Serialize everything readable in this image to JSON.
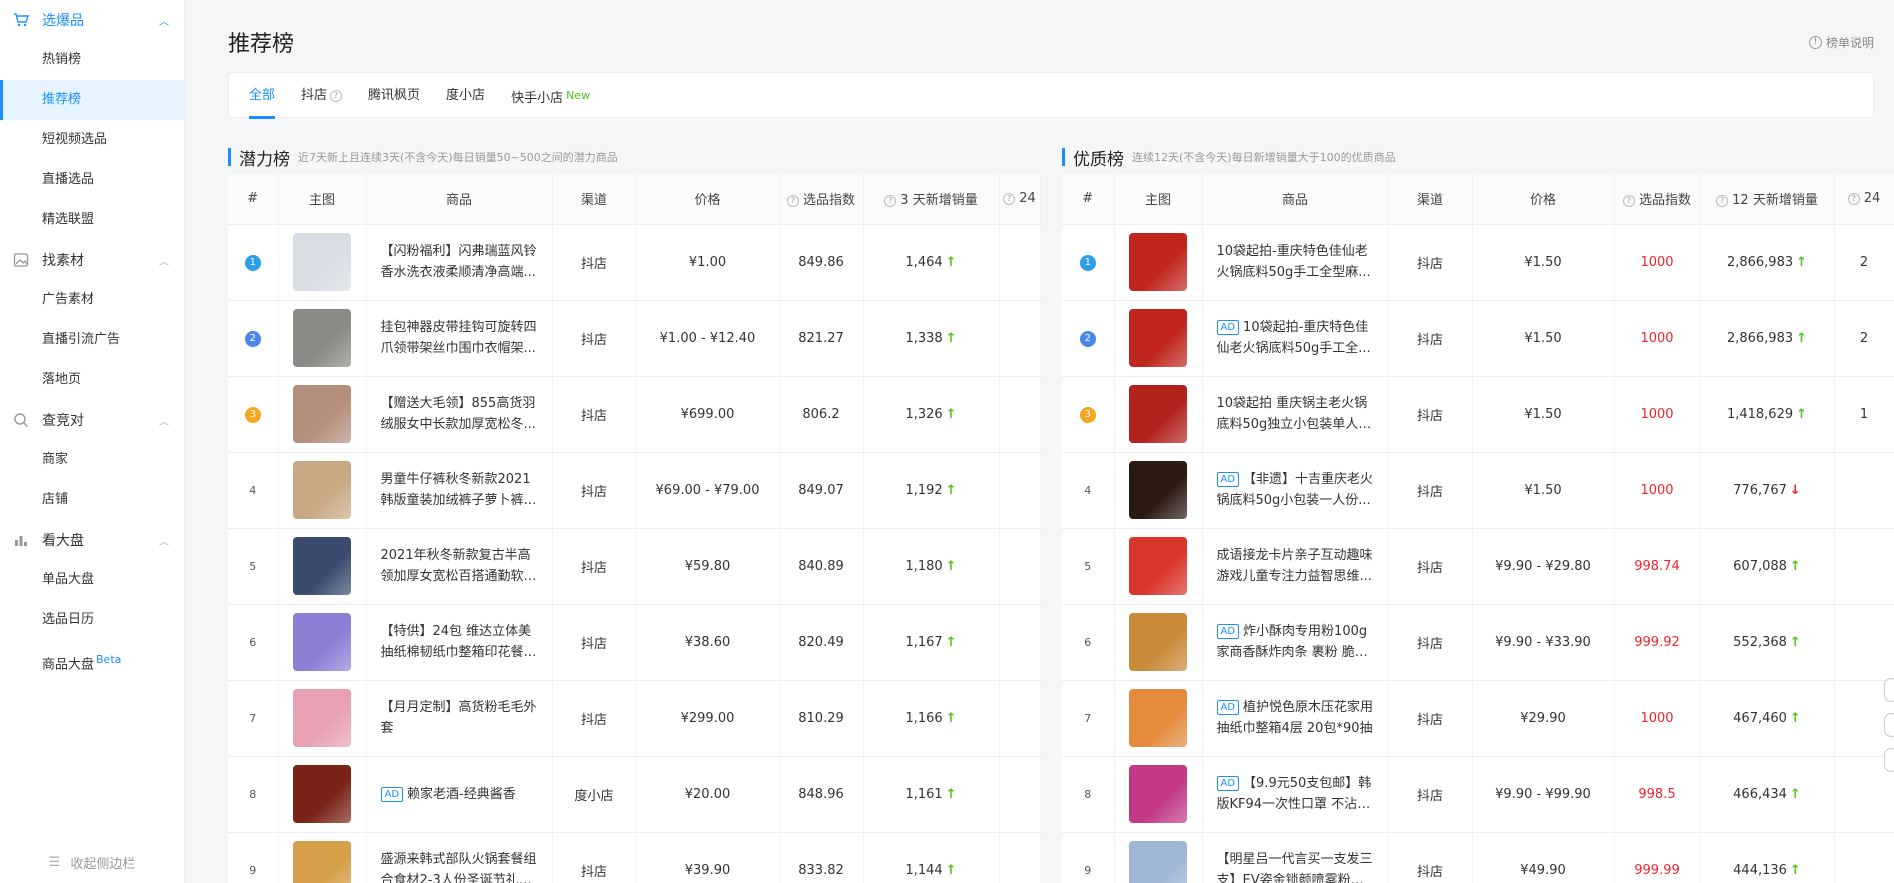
{
  "sidebar": {
    "groups": [
      {
        "label": "选爆品",
        "icon": "cart-icon",
        "items": [
          "热销榜",
          "推荐榜",
          "短视频选品",
          "直播选品",
          "精选联盟"
        ]
      },
      {
        "label": "找素材",
        "icon": "image-icon",
        "items": [
          "广告素材",
          "直播引流广告",
          "落地页"
        ]
      },
      {
        "label": "查竞对",
        "icon": "search-icon",
        "items": [
          "商家",
          "店铺"
        ]
      },
      {
        "label": "看大盘",
        "icon": "bar-chart-icon",
        "items": [
          "单品大盘",
          "选品日历",
          "商品大盘"
        ]
      }
    ],
    "beta_label": "Beta",
    "collapse_label": "收起侧边栏"
  },
  "page": {
    "title": "推荐榜",
    "help_label": "榜单说明"
  },
  "tabs": [
    {
      "label": "全部"
    },
    {
      "label": "抖店"
    },
    {
      "label": "腾讯枫页"
    },
    {
      "label": "度小店"
    },
    {
      "label": "快手小店",
      "badge": "New"
    }
  ],
  "left_panel": {
    "title": "潜力榜",
    "subtitle": "近7天新上且连续3天(不含今天)每日销量50~500之间的潜力商品",
    "columns": [
      "#",
      "主图",
      "商品",
      "渠道",
      "价格",
      "选品指数",
      "3 天新增销量",
      "24"
    ],
    "rows": [
      {
        "rank": "1",
        "name": "【闪粉福利】闪弗瑞蓝风铃香水洗衣液柔顺清净高端...",
        "ad": false,
        "channel": "抖店",
        "price": "¥1.00",
        "index": "849.86",
        "sales": "1,464",
        "trend": "up",
        "thumb": "#d9dde3"
      },
      {
        "rank": "2",
        "name": "挂包神器皮带挂钩可旋转四爪领带架丝巾围巾衣帽架...",
        "ad": false,
        "channel": "抖店",
        "price": "¥1.00 - ¥12.40",
        "index": "821.27",
        "sales": "1,338",
        "trend": "up",
        "thumb": "#8c8a86"
      },
      {
        "rank": "3",
        "name": "【赠送大毛领】855高货羽绒服女中长款加厚宽松冬...",
        "ad": false,
        "channel": "抖店",
        "price": "¥699.00",
        "index": "806.2",
        "sales": "1,326",
        "trend": "up",
        "thumb": "#b58f7d"
      },
      {
        "rank": "4",
        "name": "男童牛仔裤秋冬新款2021韩版童装加绒裤子萝卜裤中...",
        "ad": false,
        "channel": "抖店",
        "price": "¥69.00 - ¥79.00",
        "index": "849.07",
        "sales": "1,192",
        "trend": "up",
        "thumb": "#c9a984"
      },
      {
        "rank": "5",
        "name": "2021年秋冬新款复古半高领加厚女宽松百搭通勤软糯...",
        "ad": false,
        "channel": "抖店",
        "price": "¥59.80",
        "index": "840.89",
        "sales": "1,180",
        "trend": "up",
        "thumb": "#3a4b6e"
      },
      {
        "rank": "6",
        "name": "【特供】24包 维达立体美抽纸棉韧纸巾整箱印花餐巾...",
        "ad": false,
        "channel": "抖店",
        "price": "¥38.60",
        "index": "820.49",
        "sales": "1,167",
        "trend": "up",
        "thumb": "#8e7fd6"
      },
      {
        "rank": "7",
        "name": "【月月定制】高货粉毛毛外套",
        "ad": false,
        "channel": "抖店",
        "price": "¥299.00",
        "index": "810.29",
        "sales": "1,166",
        "trend": "up",
        "thumb": "#e7a1b2"
      },
      {
        "rank": "8",
        "name": "赖家老酒-经典酱香",
        "ad": true,
        "channel": "度小店",
        "price": "¥20.00",
        "index": "848.96",
        "sales": "1,161",
        "trend": "up",
        "thumb": "#7a2418"
      },
      {
        "rank": "9",
        "name": "盛源来韩式部队火锅套餐组合食材2-3人份圣诞节礼物...",
        "ad": false,
        "channel": "抖店",
        "price": "¥39.90",
        "index": "833.82",
        "sales": "1,144",
        "trend": "up",
        "thumb": "#d6a04a"
      }
    ]
  },
  "right_panel": {
    "title": "优质榜",
    "subtitle": "连续12天(不含今天)每日新增销量大于100的优质商品",
    "columns": [
      "#",
      "主图",
      "商品",
      "渠道",
      "价格",
      "选品指数",
      "12 天新增销量",
      "24"
    ],
    "rows": [
      {
        "rank": "1",
        "name": "10袋起拍-重庆特色佳仙老火锅底料50g手工全型麻...",
        "ad": false,
        "channel": "抖店",
        "price": "¥1.50",
        "index": "1000",
        "sales": "2,866,983",
        "trend": "up",
        "thumb": "#c0261f",
        "extra": "2"
      },
      {
        "rank": "2",
        "name": "10袋起拍-重庆特色佳仙老火锅底料50g手工全...",
        "ad": true,
        "channel": "抖店",
        "price": "¥1.50",
        "index": "1000",
        "sales": "2,866,983",
        "trend": "up",
        "thumb": "#c0261f",
        "extra": "2"
      },
      {
        "rank": "3",
        "name": "10袋起拍 重庆锅主老火锅底料50g独立小包装单人份...",
        "ad": false,
        "channel": "抖店",
        "price": "¥1.50",
        "index": "1000",
        "sales": "1,418,629",
        "trend": "up",
        "thumb": "#b3231d",
        "extra": "1"
      },
      {
        "rank": "4",
        "name": "【非遗】十吉重庆老火锅底料50g小包装一人份...",
        "ad": true,
        "channel": "抖店",
        "price": "¥1.50",
        "index": "1000",
        "sales": "776,767",
        "trend": "down",
        "thumb": "#2b1a12",
        "extra": ""
      },
      {
        "rank": "5",
        "name": "成语接龙卡片亲子互动趣味游戏儿童专注力益智思维...",
        "ad": false,
        "channel": "抖店",
        "price": "¥9.90 - ¥29.80",
        "index": "998.74",
        "sales": "607,088",
        "trend": "up",
        "thumb": "#d9362c",
        "extra": ""
      },
      {
        "rank": "6",
        "name": "炸小酥肉专用粉100g家商香酥炸肉条 裹粉 脆皮...",
        "ad": true,
        "channel": "抖店",
        "price": "¥9.90 - ¥33.90",
        "index": "999.92",
        "sales": "552,368",
        "trend": "up",
        "thumb": "#c98a3a",
        "extra": ""
      },
      {
        "rank": "7",
        "name": "植护悦色原木压花家用抽纸巾整箱4层 20包*90抽",
        "ad": true,
        "channel": "抖店",
        "price": "¥29.90",
        "index": "1000",
        "sales": "467,460",
        "trend": "up",
        "thumb": "#e38a3c",
        "extra": ""
      },
      {
        "rank": "8",
        "name": "【9.9元50支包邮】韩版KF94一次性口罩 不沾口...",
        "ad": true,
        "channel": "抖店",
        "price": "¥9.90 - ¥99.90",
        "index": "998.5",
        "sales": "466,434",
        "trend": "up",
        "thumb": "#c23a86",
        "extra": ""
      },
      {
        "rank": "9",
        "name": "【明星吕一代言买一支发三支】EV姿金锁颜喷雾粉底液...",
        "ad": false,
        "channel": "抖店",
        "price": "¥49.90",
        "index": "999.99",
        "sales": "444,136",
        "trend": "up",
        "thumb": "#9fb6d4",
        "extra": ""
      }
    ]
  }
}
